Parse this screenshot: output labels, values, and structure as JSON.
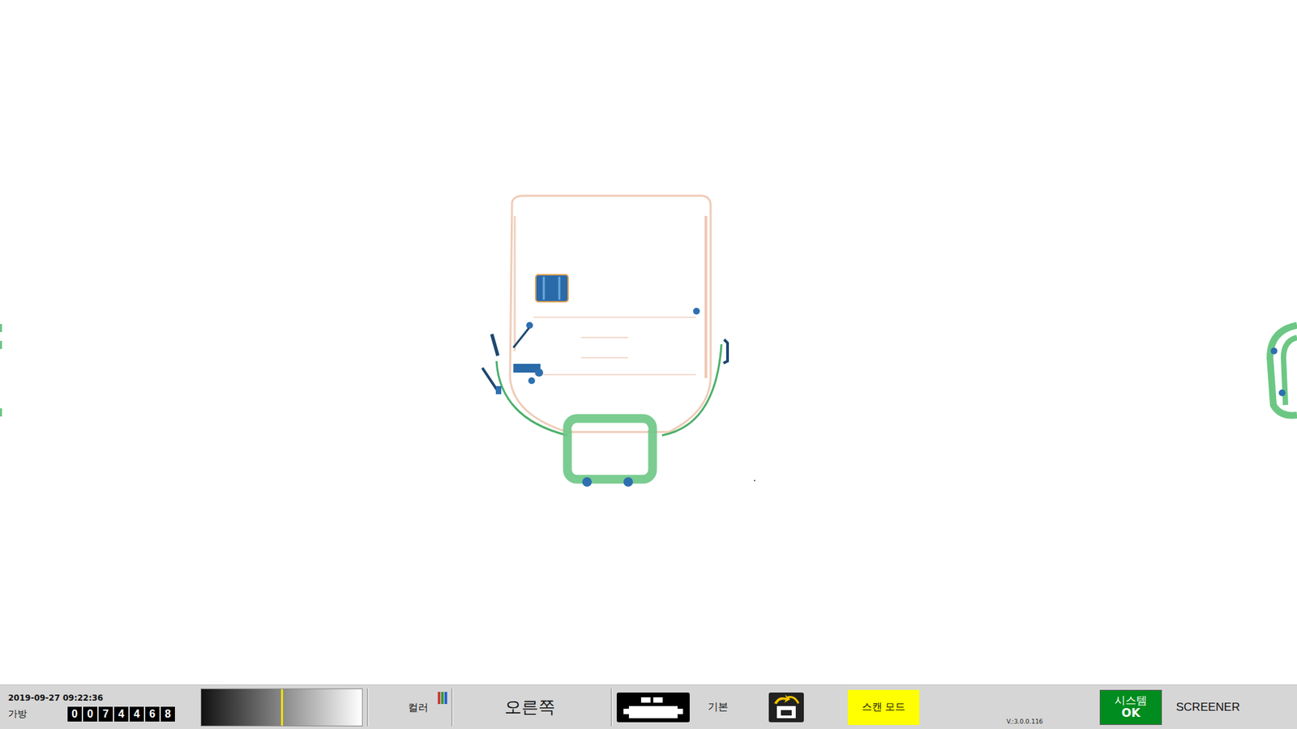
{
  "scan": {
    "content": "x-ray bag image"
  },
  "status_bar": {
    "datetime": "2019-09-27 09:22:36",
    "bag_label": "가방",
    "bag_count": [
      "0",
      "0",
      "7",
      "4",
      "4",
      "6",
      "8"
    ],
    "contrast": {
      "level": 0.5
    },
    "color_label": "컬러",
    "direction": "오른쪽",
    "mode_label": "기본",
    "scan_mode": "스캔 모드",
    "version": "V.:3.0.0.116",
    "system": {
      "label": "시스템",
      "status": "OK"
    },
    "user": "SCREENER"
  }
}
